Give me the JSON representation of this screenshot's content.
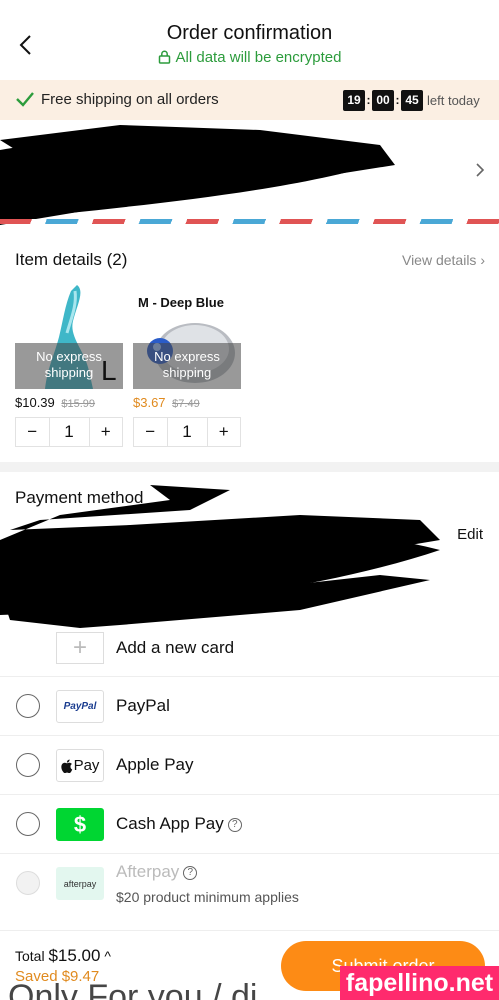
{
  "header": {
    "title": "Order confirmation",
    "encrypted_text": "All data will be encrypted"
  },
  "shipping_banner": {
    "text": "Free shipping on all orders",
    "countdown": {
      "hours": "19",
      "minutes": "00",
      "seconds": "45",
      "suffix": "left today"
    }
  },
  "items": {
    "title": "Item details (2)",
    "view_details": "View details",
    "products": [
      {
        "overlay": "No express shipping",
        "size_label": "L",
        "price": "$10.39",
        "old_price": "$15.99",
        "quantity": "1",
        "minus": "−",
        "plus": "+"
      },
      {
        "overlay": "No express shipping",
        "variant_label": "M - Deep Blue",
        "price": "$3.67",
        "old_price": "$7.49",
        "quantity": "1",
        "minus": "−",
        "plus": "+"
      }
    ]
  },
  "payment": {
    "title": "Payment method",
    "edit": "Edit",
    "add_card_label": "Add a new card",
    "methods": [
      {
        "label": "PayPal",
        "logo_text": "PayPal"
      },
      {
        "label": "Apple Pay",
        "logo_text": "Pay"
      },
      {
        "label": "Cash App Pay",
        "logo_text": "$"
      },
      {
        "label": "Afterpay",
        "logo_text": "afterpay",
        "note": "$20 product minimum applies"
      }
    ]
  },
  "footer": {
    "total_label": "Total",
    "total_value": "$15.00",
    "saved": "Saved $9.47",
    "submit": "Submit order"
  },
  "watermark": "fapellino.net",
  "bottom_text": "Only For you / di"
}
